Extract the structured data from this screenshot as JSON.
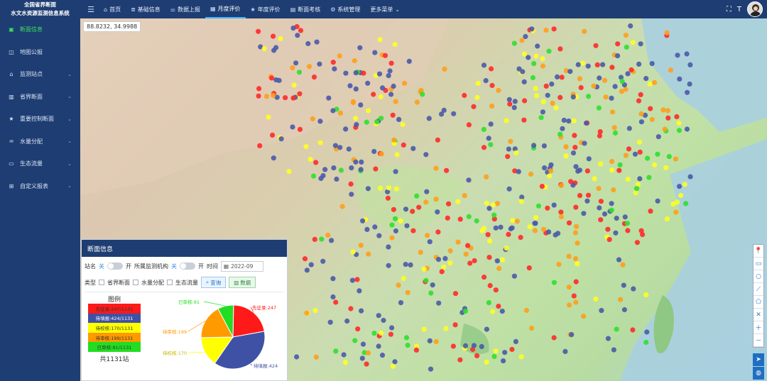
{
  "app": {
    "title_line1": "全国省界断面",
    "title_line2": "水文水资源监测信息系统"
  },
  "nav": {
    "menu_icon": "hamburger-icon",
    "items": [
      {
        "label": "首页",
        "icon": "home-icon"
      },
      {
        "label": "基础信息",
        "icon": "list-icon"
      },
      {
        "label": "数据上报",
        "icon": "sliders-icon"
      },
      {
        "label": "月度评价",
        "icon": "calendar-icon",
        "active": true
      },
      {
        "label": "年度评价",
        "icon": "star-icon"
      },
      {
        "label": "断面考核",
        "icon": "table-icon"
      },
      {
        "label": "系统管理",
        "icon": "gear-icon"
      },
      {
        "label": "更多菜单",
        "icon": "chevron-down-icon"
      }
    ]
  },
  "sidebar": {
    "items": [
      {
        "label": "断面信息",
        "active": true
      },
      {
        "label": "地图公报"
      },
      {
        "label": "监测站点",
        "chevron": true
      },
      {
        "label": "省界断面",
        "chevron": true
      },
      {
        "label": "重要控制断面",
        "chevron": true
      },
      {
        "label": "水量分配",
        "chevron": true
      },
      {
        "label": "生态流量",
        "chevron": true
      },
      {
        "label": "自定义报表",
        "chevron": true
      }
    ]
  },
  "map": {
    "coord": "88.8232, 34.9988"
  },
  "panel": {
    "title": "断面信息",
    "station_name": "站名",
    "off": "关",
    "on": "开",
    "org": "所属监测机构",
    "time": "时间",
    "date": "2022-09",
    "type": "类型",
    "opt1": "省界断面",
    "opt2": "水量分配",
    "opt3": "生态流量",
    "query": "查询",
    "data_btn": "数据",
    "legend_title": "图例",
    "legend": [
      {
        "label": "先征录:247/1131",
        "color": "#ff1a1a"
      },
      {
        "label": "待填报:424/1131",
        "color": "#3f51a5"
      },
      {
        "label": "待校核:170/1131",
        "color": "#ffff00"
      },
      {
        "label": "待审核:199/1131",
        "color": "#ff9a00"
      },
      {
        "label": "已审核:91/1131",
        "color": "#22dd22"
      }
    ],
    "total": "共1131站"
  },
  "chart_data": {
    "type": "pie",
    "categories": [
      "先征录",
      "待填报",
      "待校核",
      "待审核",
      "已审核"
    ],
    "values": [
      247,
      424,
      170,
      199,
      91
    ],
    "labels": [
      "先征录:247",
      "待填报:424",
      "待校核:170",
      "待审核:199",
      "已审核:91"
    ],
    "colors": [
      "#ff1a1a",
      "#3f51a5",
      "#ffff00",
      "#ff9a00",
      "#22dd22"
    ]
  }
}
